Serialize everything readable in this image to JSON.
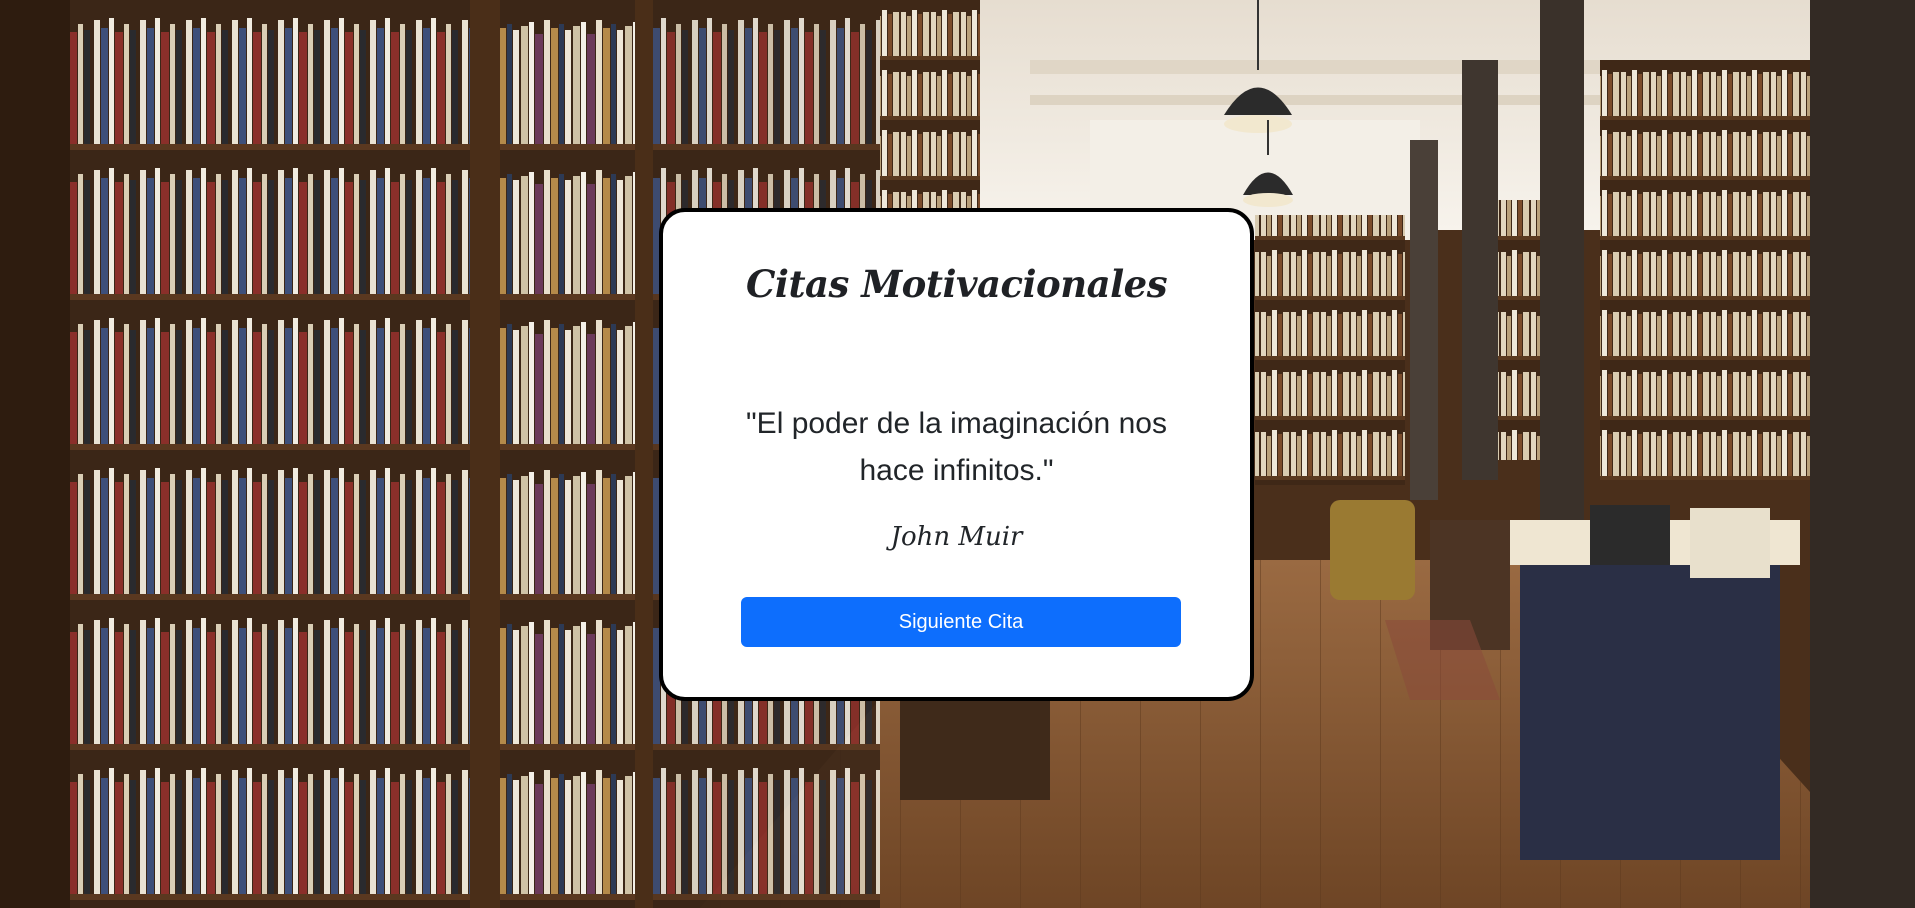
{
  "background": {
    "image": "bookstore-library-interior",
    "colors": {
      "wood_dark": "#3a2414",
      "wood_mid": "#6b4426",
      "floor": "#8a5a34",
      "ceiling": "#efe9df"
    }
  },
  "card": {
    "title": "Citas Motivacionales",
    "quote": "\"El poder de la imaginación nos hace infinitos.\"",
    "author": "John Muir",
    "button_label": "Siguiente Cita",
    "colors": {
      "card_background": "#ffffff",
      "card_border": "#000000",
      "button_background": "#0d6efd",
      "button_text": "#ffffff",
      "text": "#212529"
    }
  }
}
